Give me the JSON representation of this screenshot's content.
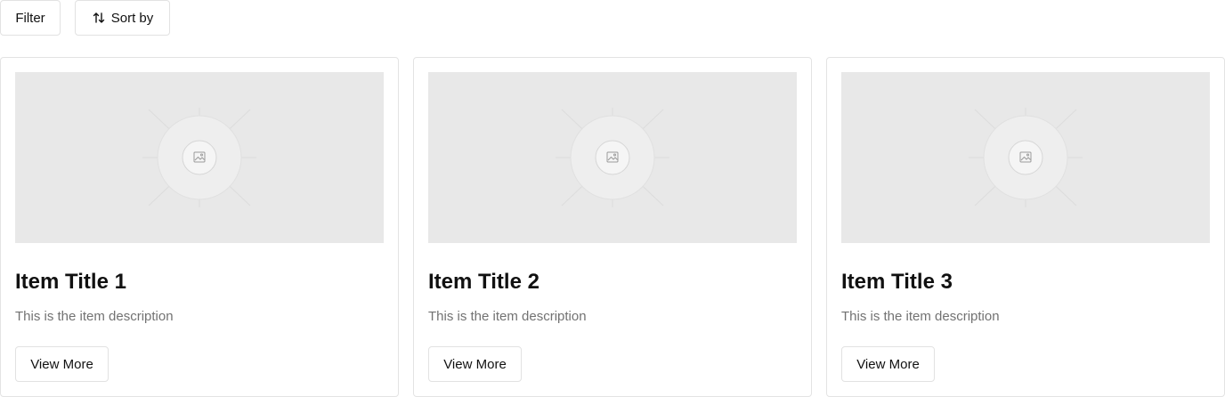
{
  "toolbar": {
    "filter_label": "Filter",
    "sort_label": "Sort by",
    "sort_icon": "arrow-up-down-icon"
  },
  "cards": [
    {
      "title": "Item Title 1",
      "description": "This is the item description",
      "button_label": "View More",
      "image_icon": "image-placeholder-icon"
    },
    {
      "title": "Item Title 2",
      "description": "This is the item description",
      "button_label": "View More",
      "image_icon": "image-placeholder-icon"
    },
    {
      "title": "Item Title 3",
      "description": "This is the item description",
      "button_label": "View More",
      "image_icon": "image-placeholder-icon"
    }
  ],
  "colors": {
    "placeholder_bg": "#e8e8e8",
    "border": "#e2e2e2",
    "description_text": "#727272",
    "text": "#111111"
  }
}
